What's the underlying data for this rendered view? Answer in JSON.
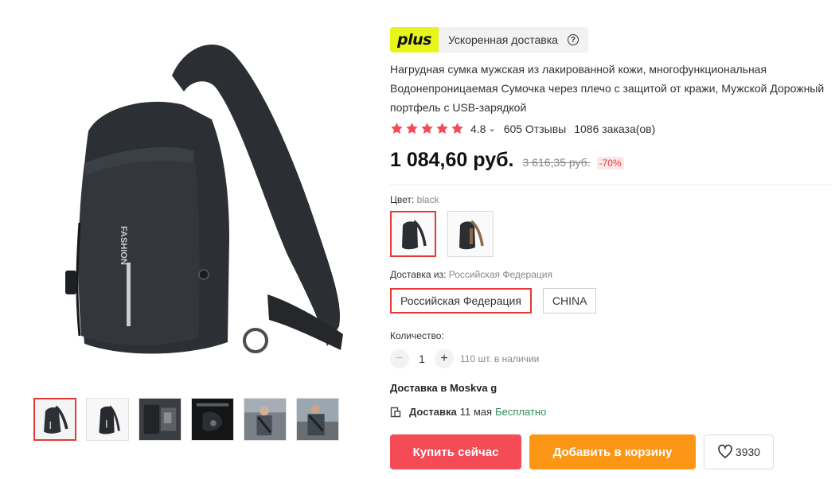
{
  "plus": {
    "logo_text": "plus",
    "label": "Ускоренная доставка",
    "help_glyph": "?"
  },
  "product": {
    "title": "Нагрудная сумка мужская из лакированной кожи, многофункциональная Водонепроницаемая Сумочка через плечо с защитой от кражи, Мужской Дорожный портфель с USB-зарядкой",
    "bag_print": "FASHION"
  },
  "rating": {
    "value": "4.8",
    "reviews": "605 Отзывы",
    "orders": "1086 заказа(ов)",
    "stars_filled": 5,
    "star_color": "#f44b56"
  },
  "price": {
    "current": "1 084,60 руб.",
    "old": "3 616,35 руб.",
    "discount": "-70%"
  },
  "color": {
    "label": "Цвет:",
    "selected": "black",
    "options": [
      {
        "name": "black"
      },
      {
        "name": "brown-accent"
      }
    ]
  },
  "shipping": {
    "label": "Доставка из:",
    "selected": "Российская Федерация",
    "options": [
      "Российская Федерация",
      "CHINA"
    ]
  },
  "quantity": {
    "label": "Количество:",
    "value": "1",
    "minus": "−",
    "plus": "+",
    "stock": "110 шт. в наличии"
  },
  "delivery": {
    "destination": "Доставка в Moskva g",
    "label": "Доставка",
    "date": "11 мая",
    "cost": "Бесплатно"
  },
  "buttons": {
    "buy": "Купить сейчас",
    "cart": "Добавить в корзину",
    "wishlist_count": "3930"
  },
  "colors": {
    "accent_red": "#e53935",
    "buy_button": "#f44b56",
    "cart_button": "#fb9714",
    "plus_yellow": "#e6f51b",
    "free_green": "#2e8b57"
  },
  "icons": [
    "help-icon",
    "star-icon",
    "chevron-down-icon",
    "box-icon",
    "heart-icon"
  ]
}
